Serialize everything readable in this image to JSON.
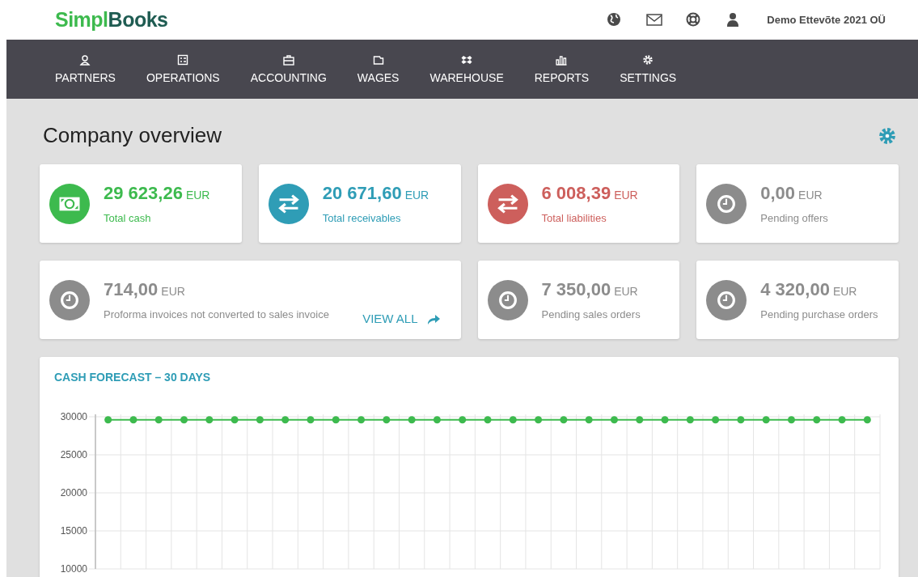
{
  "header": {
    "logo": {
      "first": "Simpl",
      "second": "Books"
    },
    "company": "Demo Ettevõte 2021 OÜ"
  },
  "nav": [
    {
      "label": "PARTNERS"
    },
    {
      "label": "OPERATIONS"
    },
    {
      "label": "ACCOUNTING"
    },
    {
      "label": "WAGES"
    },
    {
      "label": "WAREHOUSE"
    },
    {
      "label": "REPORTS"
    },
    {
      "label": "SETTINGS"
    }
  ],
  "page": {
    "title": "Company overview"
  },
  "cards": [
    {
      "value": "29 623,26",
      "currency": "EUR",
      "label": "Total cash",
      "color": "#3dba4e"
    },
    {
      "value": "20 671,60",
      "currency": "EUR",
      "label": "Total receivables",
      "color": "#2f9db6"
    },
    {
      "value": "6 008,39",
      "currency": "EUR",
      "label": "Total liabilities",
      "color": "#cd5f5c"
    },
    {
      "value": "0,00",
      "currency": "EUR",
      "label": "Pending offers",
      "color": "#8c8c8c"
    },
    {
      "value": "714,00",
      "currency": "EUR",
      "label": "Proforma invoices not converted to sales invoice",
      "color": "#8c8c8c",
      "link": "VIEW ALL"
    },
    {
      "value": "7 350,00",
      "currency": "EUR",
      "label": "Pending sales orders",
      "color": "#8c8c8c"
    },
    {
      "value": "4 320,00",
      "currency": "EUR",
      "label": "Pending purchase orders",
      "color": "#8c8c8c"
    }
  ],
  "forecast": {
    "title": "CASH FORECAST – 30 DAYS",
    "chart_data": {
      "type": "line",
      "ylim": [
        10000,
        30000
      ],
      "yticks": [
        30000,
        25000,
        20000,
        15000,
        10000
      ],
      "grid": true,
      "series": [
        {
          "color": "#3dba4e",
          "marker": "circle",
          "values": [
            29600,
            29600,
            29600,
            29600,
            29600,
            29600,
            29600,
            29600,
            29600,
            29600,
            29600,
            29600,
            29600,
            29600,
            29600,
            29600,
            29600,
            29600,
            29600,
            29600,
            29600,
            29600,
            29600,
            29600,
            29600,
            29600,
            29600,
            29600,
            29600,
            29600,
            29600
          ]
        }
      ]
    }
  }
}
